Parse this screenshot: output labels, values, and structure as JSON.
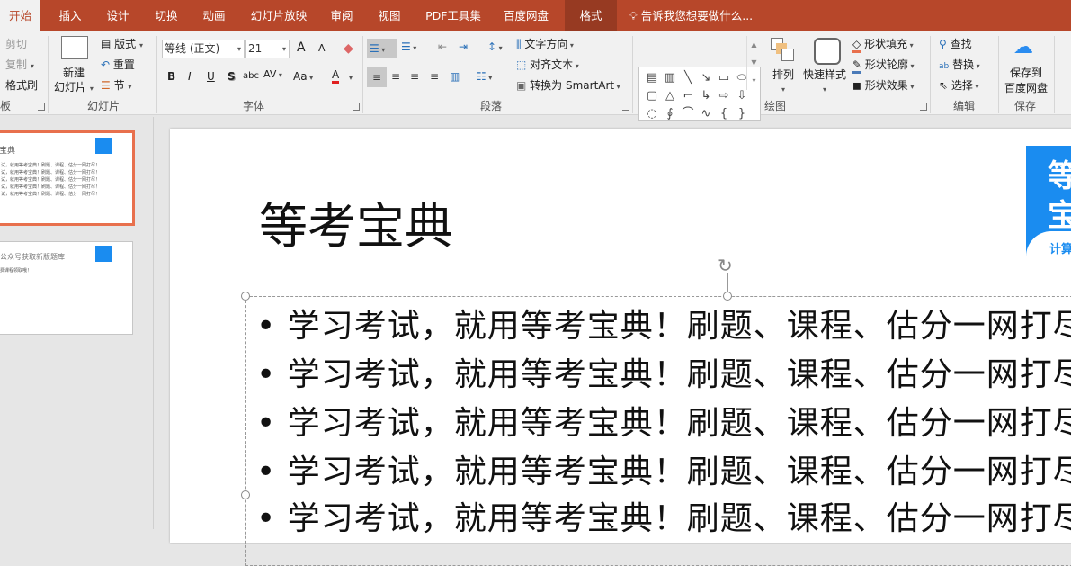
{
  "tabs": [
    "开始",
    "插入",
    "设计",
    "切换",
    "动画",
    "幻灯片放映",
    "审阅",
    "视图",
    "PDF工具集",
    "百度网盘",
    "格式"
  ],
  "tell_me": "告诉我您想要做什么...",
  "clipboard": {
    "cut": "剪切",
    "copy": "复制",
    "painter": "格式刷",
    "label": "板"
  },
  "slides_group": {
    "new_slide_1": "新建",
    "new_slide_2": "幻灯片",
    "layout": "版式",
    "reset": "重置",
    "section": "节",
    "label": "幻灯片"
  },
  "font": {
    "name": "等线 (正文)",
    "size": "21",
    "bold": "B",
    "italic": "I",
    "underline": "U",
    "shadow": "S",
    "strike": "abc",
    "spacing": "AV",
    "case": "Aa",
    "color": "A",
    "grow": "A",
    "shrink": "A",
    "label": "字体",
    "color_hex": "#e02020"
  },
  "paragraph": {
    "label": "段落",
    "text_direction": "文字方向",
    "align_text": "对齐文本",
    "smartart": "转换为 SmartArt"
  },
  "drawing": {
    "arrange": "排列",
    "quick_styles": "快速样式",
    "fill": "形状填充",
    "outline": "形状轮廓",
    "effects": "形状效果",
    "label": "绘图"
  },
  "editing": {
    "find": "查找",
    "replace": "替换",
    "select": "选择",
    "label": "编辑"
  },
  "save": {
    "line1": "保存到",
    "line2": "百度网盘",
    "label": "保存"
  },
  "thumbnails": [
    {
      "title": "宝典",
      "lines": [
        "试，就用等考宝典！刷题、课程、估分一网打尽！",
        "试，就用等考宝典！刷题、课程、估分一网打尽！",
        "试，就用等考宝典！刷题、课程、估分一网打尽！",
        "试，就用等考宝典！刷题、课程、估分一网打尽！",
        "试，就用等考宝典！刷题、课程、估分一网打尽！"
      ]
    },
    {
      "title": "公众号获取新版题库",
      "lines": [
        "费课程领取哦！"
      ]
    }
  ],
  "slide": {
    "title": "等考宝典",
    "bullets": [
      "学习考试，就用等考宝典！刷题、课程、估分一网打尽！",
      "学习考试，就用等考宝典！刷题、课程、估分一网打尽！",
      "学习考试，就用等考宝典！刷题、课程、估分一网打尽！",
      "学习考试，就用等考宝典！刷题、课程、估分一网打尽！",
      "学习考试，就用等考宝典！刷题、课程、估分一网打尽！"
    ],
    "logo_line1": "等",
    "logo_line2": "宝",
    "logo_caption": "计算"
  },
  "colors": {
    "brand": "#b7472a",
    "selected_border": "#e8704d",
    "logo": "#1a8cf0"
  }
}
